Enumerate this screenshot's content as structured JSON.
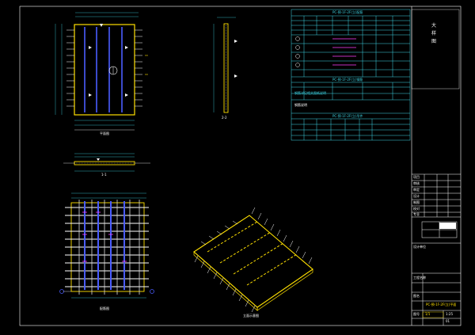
{
  "views": {
    "top_plan_label": "平面图",
    "section_1_1": "1-1",
    "section_2_2": "2-2",
    "rebar_plan_label": "配筋图",
    "iso_label": "立面示意图"
  },
  "side_notes": {
    "line1": "大",
    "line2": "样",
    "line3": "图"
  },
  "tables": {
    "table1_title": "PC-预-1F-2F(立)配筋",
    "table2_title": "PC-预-1F-2F(立)钢筋",
    "table3_title": "PC-预-1F-2F(立)吊件",
    "caption_left": "钢筋说明",
    "rebar_notes": "钢筋详见相关图纸说明"
  },
  "title_block": {
    "project_no": "1/1",
    "drawing_name": "PC-预-1F-2F(立)平面",
    "scale": "1:25",
    "row_labels": [
      "项目",
      "审核",
      "审定",
      "设计",
      "制图",
      "校对",
      "专业"
    ],
    "field_a": "设计单位",
    "field_b": "工程名称",
    "field_c": "图名",
    "field_d": "图号",
    "sheet_no": "01"
  },
  "colors": {
    "cyan": "#3fd8e8",
    "yellow": "#ffe000",
    "magenta": "#ff40ff",
    "blue": "#4a5cff",
    "white": "#ffffff",
    "red": "#ff3030"
  }
}
